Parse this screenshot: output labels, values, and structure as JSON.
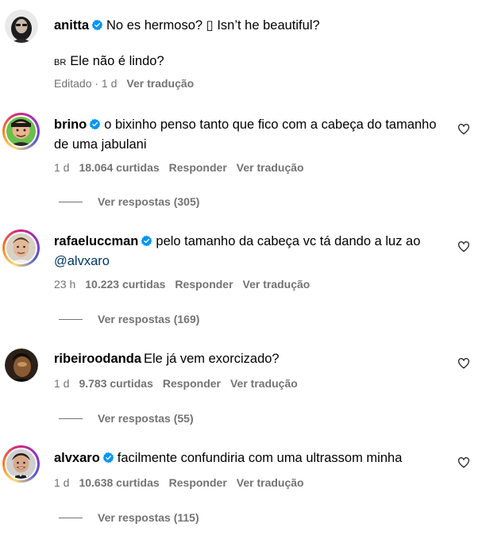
{
  "post_caption": {
    "username": "anitta",
    "text": "No es hermoso? ▯ Isn’t he beautiful?",
    "translation_flag": "BR",
    "translation_text": "Ele não é lindo?",
    "edited_label": "Editado · 1 d",
    "see_translation": "Ver tradução"
  },
  "comments": [
    {
      "username": "brino",
      "text": "o bixinho penso tanto que fico com a cabeça do tamanho de uma jabulani",
      "time": "1 d",
      "likes": "18.064 curtidas",
      "reply": "Responder",
      "see_translation": "Ver tradução",
      "view_replies": "Ver respostas (305)"
    },
    {
      "username": "rafaeluccman",
      "text": "pelo tamanho da cabeça vc tá dando a luz ao",
      "mention": "@alvxaro",
      "time": "23 h",
      "likes": "10.223 curtidas",
      "reply": "Responder",
      "see_translation": "Ver tradução",
      "view_replies": "Ver respostas (169)"
    },
    {
      "username": "ribeiroodanda",
      "text": "Ele já vem exorcizado?",
      "time": "1 d",
      "likes": "9.783 curtidas",
      "reply": "Responder",
      "see_translation": "Ver tradução",
      "view_replies": "Ver respostas (55)"
    },
    {
      "username": "alvxaro",
      "text": "facilmente confundiria com uma ultrassom minha",
      "time": "1 d",
      "likes": "10.638 curtidas",
      "reply": "Responder",
      "see_translation": "Ver tradução",
      "view_replies": "Ver respostas (115)"
    }
  ],
  "colors": {
    "verified_blue": "#0095f6",
    "meta_gray": "#737373",
    "mention_blue": "#00376b"
  },
  "icons": {
    "like": "heart-outline-icon",
    "verified": "verified-badge-icon"
  }
}
